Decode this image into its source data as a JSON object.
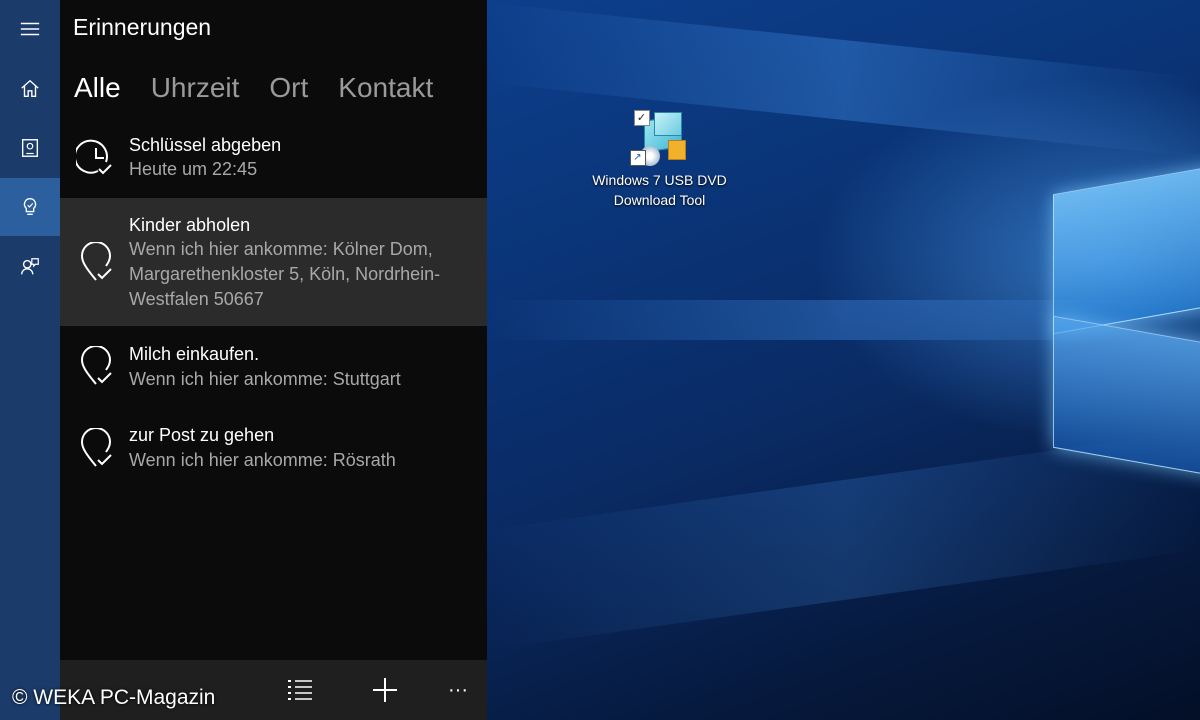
{
  "app": {
    "title": "Erinnerungen",
    "tabs": [
      {
        "label": "Alle",
        "active": true
      },
      {
        "label": "Uhrzeit",
        "active": false
      },
      {
        "label": "Ort",
        "active": false
      },
      {
        "label": "Kontakt",
        "active": false
      }
    ],
    "items": [
      {
        "icon": "clock-check-icon",
        "title": "Schlüssel abgeben",
        "detail": "Heute um 22:45"
      },
      {
        "icon": "location-check-icon",
        "title": "Kinder abholen",
        "detail": "Wenn ich hier ankomme: Kölner Dom, Margarethenkloster 5, Köln, Nordrhein-Westfalen 50667"
      },
      {
        "icon": "location-check-icon",
        "title": "Milch einkaufen.",
        "detail": "Wenn ich hier ankomme: Stuttgart"
      },
      {
        "icon": "location-check-icon",
        "title": "zur Post zu gehen",
        "detail": "Wenn ich hier ankomme: Rösrath"
      }
    ]
  },
  "rail": {
    "items": [
      "hamburger-menu-icon",
      "home-icon",
      "notebook-icon",
      "reminders-lightbulb-icon",
      "feedback-icon"
    ],
    "active_index": 3,
    "accent": "#2c5f9e"
  },
  "appbar": {
    "buttons": [
      "list-select-icon",
      "add-icon",
      "more-icon"
    ],
    "more_label": "···",
    "add_label": "+"
  },
  "desktop": {
    "icon_label_line1": "Windows 7 USB DVD",
    "icon_label_line2": "Download Tool"
  },
  "credit": "© WEKA PC-Magazin"
}
